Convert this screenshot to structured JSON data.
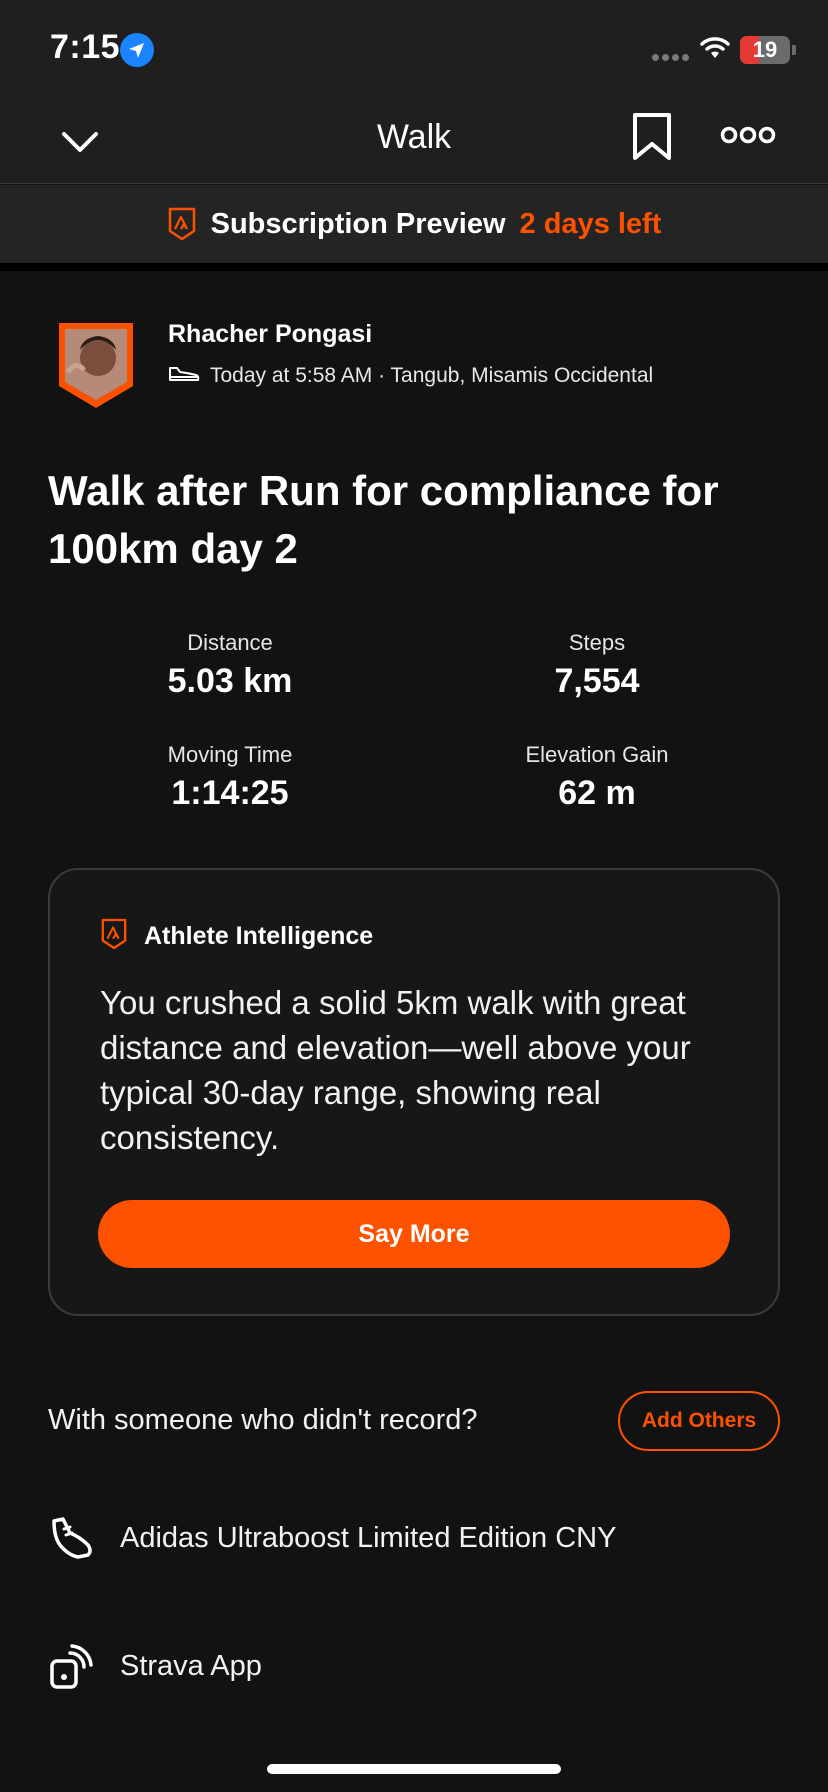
{
  "status_bar": {
    "time": "7:15",
    "battery": "19"
  },
  "nav": {
    "title": "Walk"
  },
  "subscription": {
    "label": "Subscription Preview",
    "days_left": "2 days left"
  },
  "athlete": {
    "name": "Rhacher Pongasi",
    "meta": "Today at 5:58 AM · Tangub, Misamis Occidental"
  },
  "activity": {
    "title": "Walk after Run for compliance for 100km day 2"
  },
  "stats": [
    {
      "label": "Distance",
      "value": "5.03 km"
    },
    {
      "label": "Steps",
      "value": "7,554"
    },
    {
      "label": "Moving Time",
      "value": "1:14:25"
    },
    {
      "label": "Elevation Gain",
      "value": "62 m"
    }
  ],
  "ai": {
    "title": "Athlete Intelligence",
    "body": "You crushed a solid 5km walk with great distance and elevation—well above your typical 30-day range, showing real consistency.",
    "button": "Say More"
  },
  "with_others": {
    "prompt": "With someone who didn't record?",
    "button": "Add Others"
  },
  "gear": [
    {
      "icon": "shoe-icon",
      "label": "Adidas Ultraboost Limited Edition CNY"
    },
    {
      "icon": "device-icon",
      "label": "Strava App"
    }
  ],
  "colors": {
    "accent": "#fc5200",
    "background": "#121212",
    "bar": "#1f1f1f"
  }
}
